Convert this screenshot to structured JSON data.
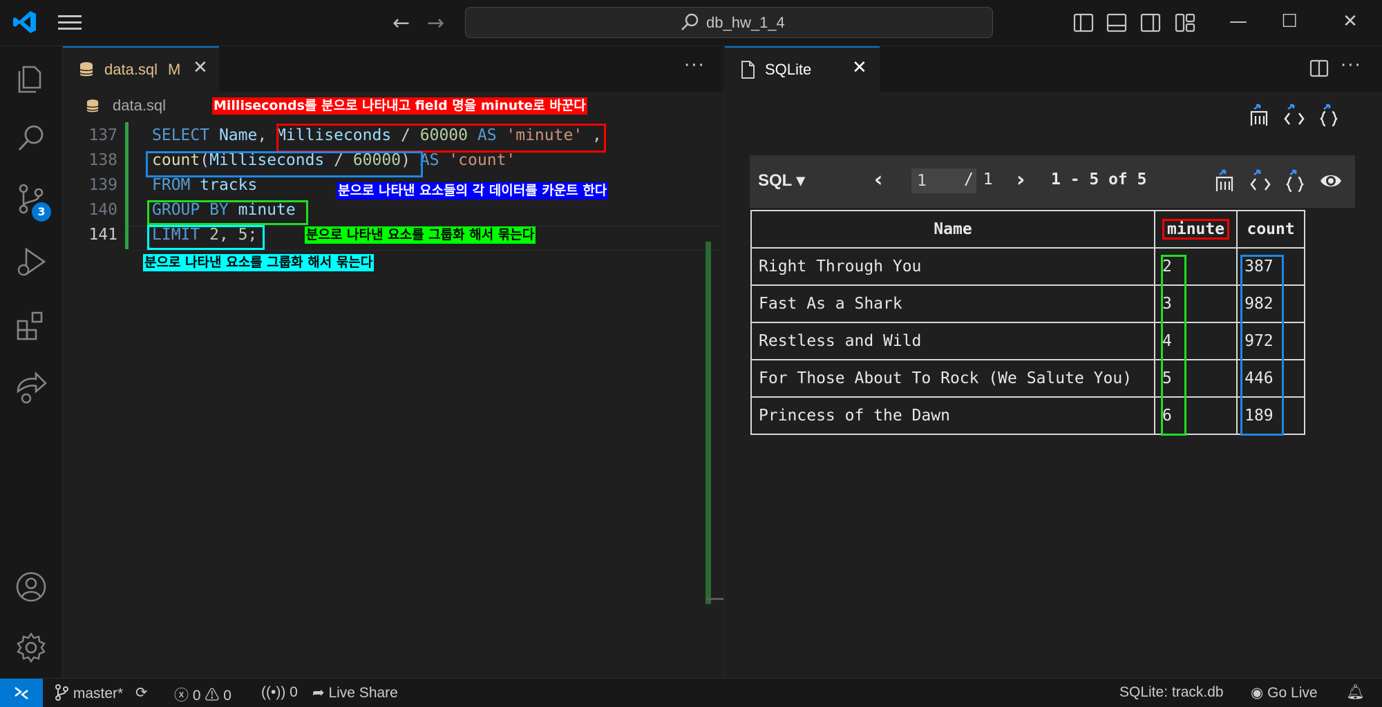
{
  "titlebar": {
    "search_text": "db_hw_1_4",
    "nav_back": "←",
    "nav_forward": "→",
    "minimize": "—",
    "maximize": "☐",
    "close": "✕"
  },
  "activity_bar": {
    "items": [
      "explorer-icon",
      "search-icon",
      "source-control-icon",
      "run-debug-icon",
      "extensions-icon",
      "live-share-icon"
    ],
    "scm_badge": "3",
    "bottom": [
      "accounts-icon",
      "manage-gear-icon"
    ]
  },
  "editor": {
    "tab_label": "data.sql",
    "tab_status": "M",
    "tab_close": "✕",
    "more": "···",
    "breadcrumb": "data.sql",
    "lines": [
      {
        "number": "137",
        "tokens": [
          [
            "kw",
            "SELECT "
          ],
          [
            "id",
            "Name"
          ],
          [
            "pl",
            ", "
          ],
          [
            "id",
            "Milliseconds"
          ],
          [
            "pl",
            " / "
          ],
          [
            "num",
            "60000"
          ],
          [
            "kw",
            " AS "
          ],
          [
            "str",
            "'minute'"
          ],
          [
            "pl",
            " ,"
          ]
        ]
      },
      {
        "number": "138",
        "tokens": [
          [
            "fn",
            "count"
          ],
          [
            "pl",
            "("
          ],
          [
            "id",
            "Milliseconds"
          ],
          [
            "pl",
            " / "
          ],
          [
            "num",
            "60000"
          ],
          [
            "pl",
            ") "
          ],
          [
            "kw",
            "AS "
          ],
          [
            "str",
            "'count'"
          ]
        ]
      },
      {
        "number": "139",
        "tokens": [
          [
            "kw",
            "FROM "
          ],
          [
            "id",
            "tracks"
          ]
        ]
      },
      {
        "number": "140",
        "tokens": [
          [
            "kw",
            "GROUP BY "
          ],
          [
            "id",
            "minute"
          ]
        ]
      },
      {
        "number": "141",
        "tokens": [
          [
            "kw",
            "LIMIT "
          ],
          [
            "num",
            "2"
          ],
          [
            "pl",
            ", "
          ],
          [
            "num",
            "5"
          ],
          [
            "pl",
            ";"
          ]
        ]
      }
    ],
    "annotations": {
      "red": "Milliseconds를 분으로 나타내고 field 명을 minute로 바꾼다",
      "blue": "분으로 나타낸 요소들의 각 데이터를 카운트 한다",
      "green": "분으로 나타낸 요소를 그룹화 해서 묶는다",
      "cyan": "분으로 나타낸 요소를 그룹화 해서 묶는다"
    },
    "annotation_colors": {
      "red": "#ff0000",
      "blue": "#0000ff",
      "green": "#00ff00",
      "cyan": "#00ffff",
      "box_blue": "#1e88e5",
      "box_green": "#22dd22"
    }
  },
  "sqlite_panel": {
    "tab_label": "SQLite",
    "tab_close": "✕",
    "toolbar": {
      "sql_label": "SQL ▾",
      "prev": "‹",
      "page_value": "1",
      "page_total": "/ 1",
      "next": "›",
      "range": "1 - 5 of 5"
    },
    "table": {
      "headers": [
        "Name",
        "minute",
        "count"
      ],
      "rows": [
        [
          "Right Through You",
          "2",
          "387"
        ],
        [
          "Fast As a Shark",
          "3",
          "982"
        ],
        [
          "Restless and Wild",
          "4",
          "972"
        ],
        [
          "For Those About To Rock (We Salute You)",
          "5",
          "446"
        ],
        [
          "Princess of the Dawn",
          "6",
          "189"
        ]
      ]
    }
  },
  "statusbar": {
    "branch": "master*",
    "errors": "0",
    "warnings": "0",
    "ports": "0",
    "live_share": "Live Share",
    "sqlite_db": "SQLite: track.db",
    "go_live": "Go Live"
  }
}
